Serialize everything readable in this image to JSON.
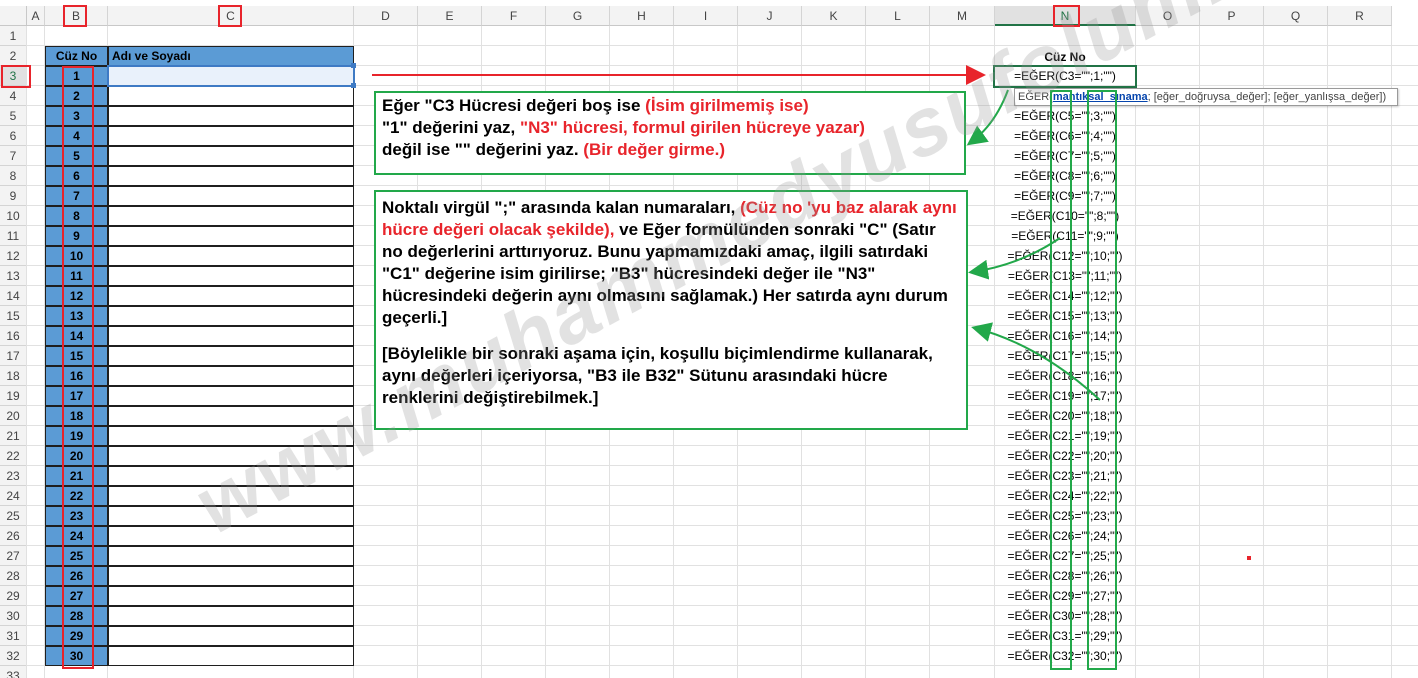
{
  "columns": [
    "A",
    "B",
    "C",
    "D",
    "E",
    "F",
    "G",
    "H",
    "I",
    "J",
    "K",
    "L",
    "M",
    "N",
    "O",
    "P",
    "Q",
    "R"
  ],
  "rows": [
    "1",
    "2",
    "3",
    "4",
    "5",
    "6",
    "7",
    "8",
    "9",
    "10",
    "11",
    "12",
    "13",
    "14",
    "15",
    "16",
    "17",
    "18",
    "19",
    "20",
    "21",
    "22",
    "23",
    "24",
    "25",
    "26",
    "27",
    "28",
    "29",
    "30",
    "31",
    "32",
    "33"
  ],
  "table": {
    "header_b": "Cüz No",
    "header_c": "Adı ve Soyadı",
    "cuz_numbers": [
      "1",
      "2",
      "3",
      "4",
      "5",
      "6",
      "7",
      "8",
      "9",
      "10",
      "11",
      "12",
      "13",
      "14",
      "15",
      "16",
      "17",
      "18",
      "19",
      "20",
      "21",
      "22",
      "23",
      "24",
      "25",
      "26",
      "27",
      "28",
      "29",
      "30"
    ]
  },
  "n_column": {
    "header": "Cüz No",
    "formulas": [
      "=EĞER(C3=\"\";1;\"\")",
      "",
      "=EĞER(C5=\"\";3;\"\")",
      "=EĞER(C6=\"\";4;\"\")",
      "=EĞER(C7=\"\";5;\"\")",
      "=EĞER(C8=\"\";6;\"\")",
      "=EĞER(C9=\"\";7;\"\")",
      "=EĞER(C10=\"\";8;\"\")",
      "=EĞER(C11=\"\";9;\"\")",
      "=EĞER(C12=\"\";10;\"\")",
      "=EĞER(C13=\"\";11;\"\")",
      "=EĞER(C14=\"\";12;\"\")",
      "=EĞER(C15=\"\";13;\"\")",
      "=EĞER(C16=\"\";14;\"\")",
      "=EĞER(C17=\"\";15;\"\")",
      "=EĞER(C18=\"\";16;\"\")",
      "=EĞER(C19=\"\";17;\"\")",
      "=EĞER(C20=\"\";18;\"\")",
      "=EĞER(C21=\"\";19;\"\")",
      "=EĞER(C22=\"\";20;\"\")",
      "=EĞER(C23=\"\";21;\"\")",
      "=EĞER(C24=\"\";22;\"\")",
      "=EĞER(C25=\"\";23;\"\")",
      "=EĞER(C26=\"\";24;\"\")",
      "=EĞER(C27=\"\";25;\"\")",
      "=EĞER(C28=\"\";26;\"\")",
      "=EĞER(C29=\"\";27;\"\")",
      "=EĞER(C30=\"\";28;\"\")",
      "=EĞER(C31=\"\";29;\"\")",
      "=EĞER(C32=\"\";30;\"\")"
    ]
  },
  "tooltip": {
    "fn": "EĞER(",
    "arg1": "mantıksal_sınama",
    "rest": "; [eğer_doğruysa_değer]; [eğer_yanlışsa_değer])"
  },
  "note1": {
    "l1a": "Eğer \"C3 Hücresi değeri boş ise ",
    "l1b": "(İsim girilmemiş ise)",
    "l2a": "\"1\" değerini yaz, ",
    "l2b": "\"N3\" hücresi, formul girilen hücreye yazar)",
    "l3a": "değil ise \"\" değerini yaz. ",
    "l3b": "(Bir değer girme.)"
  },
  "note2": {
    "p1a": "Noktalı virgül \";\" arasında kalan numaraları, ",
    "p1b": "(Cüz no 'yu baz alarak aynı hücre değeri olacak şekilde),",
    "p1c": " ve Eğer formülünden sonraki \"C\" (Satır no değerlerini  arttırıyoruz.  Bunu yapmamızdaki amaç, ilgili satırdaki \"C1\" değerine isim girilirse; \"B3\" hücresindeki değer ile \"N3\" hücresindeki değerin aynı olmasını sağlamak.) Her satırda aynı durum geçerli.]",
    "p2": "[Böylelikle bir sonraki aşama için, koşullu biçimlendirme kullanarak, aynı değerleri içeriyorsa, \"B3 ile B32\" Sütunu arasındaki hücre renklerini değiştirebilmek.]"
  },
  "watermark": "www.muhammedyusufolum.blogspot.com",
  "colors": {
    "header_fill": "#5b9bd5",
    "annotation_red": "#e8242b",
    "annotation_green": "#22a84a",
    "selected_header": "#217346"
  }
}
